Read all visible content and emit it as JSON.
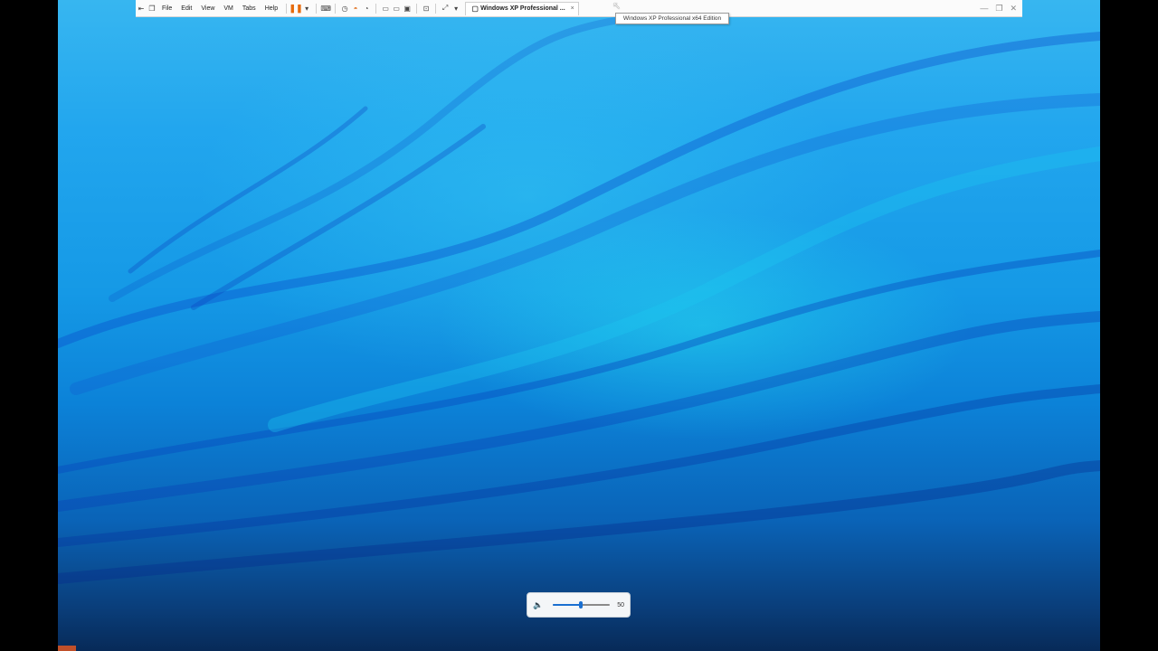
{
  "toolbar": {
    "menus": [
      "File",
      "Edit",
      "View",
      "VM",
      "Tabs",
      "Help"
    ],
    "tab_title": "Windows XP Professional ...",
    "tab_close": "×"
  },
  "tooltip": {
    "text": "Windows XP Professional x64 Edition"
  },
  "volume": {
    "value": "50",
    "level_percent": 50
  },
  "colors": {
    "accent": "#1a6fd0",
    "pause": "#e66a0a"
  }
}
